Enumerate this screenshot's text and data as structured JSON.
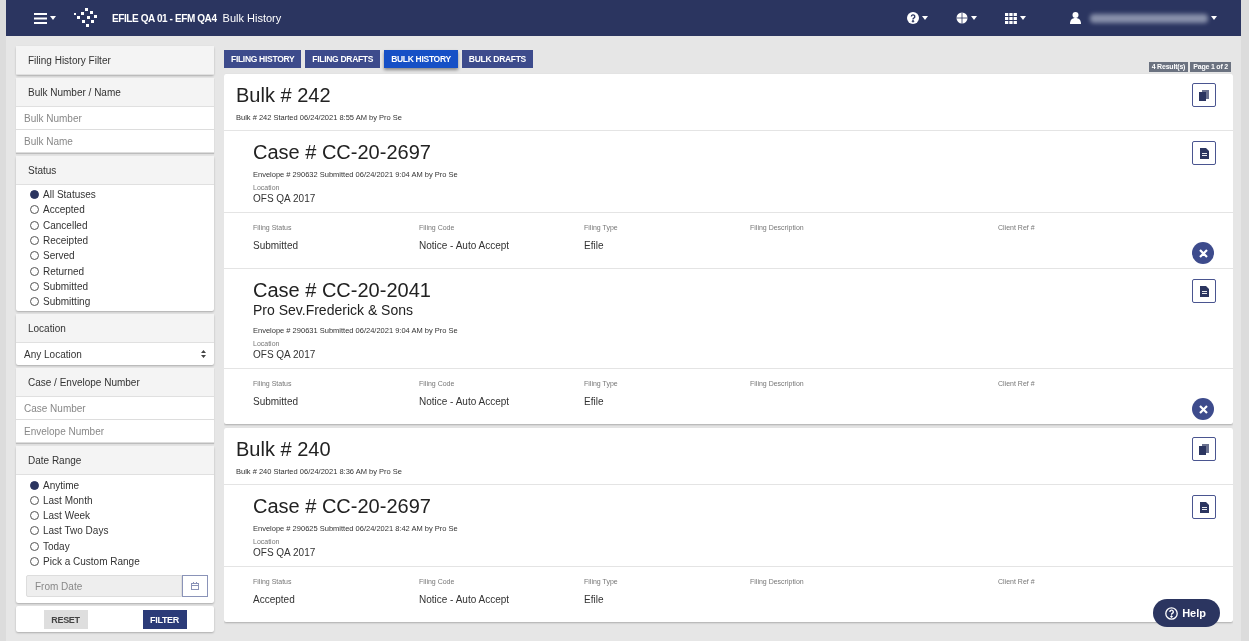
{
  "nav": {
    "brand": "EFILE QA 01 - EFM QA4",
    "page_title": "Bulk History"
  },
  "filter": {
    "title": "Filing History Filter",
    "sections": [
      {
        "kind": "fields",
        "title": "Bulk Number / Name",
        "fields": [
          {
            "placeholder": "Bulk Number"
          },
          {
            "placeholder": "Bulk Name"
          }
        ]
      },
      {
        "kind": "radios",
        "title": "Status",
        "options": [
          {
            "label": "All Statuses",
            "selected": true
          },
          {
            "label": "Accepted",
            "selected": false
          },
          {
            "label": "Cancelled",
            "selected": false
          },
          {
            "label": "Receipted",
            "selected": false
          },
          {
            "label": "Served",
            "selected": false
          },
          {
            "label": "Returned",
            "selected": false
          },
          {
            "label": "Submitted",
            "selected": false
          },
          {
            "label": "Submitting",
            "selected": false
          }
        ]
      },
      {
        "kind": "select",
        "title": "Location",
        "value": "Any Location"
      },
      {
        "kind": "fields",
        "title": "Case / Envelope Number",
        "fields": [
          {
            "placeholder": "Case Number"
          },
          {
            "placeholder": "Envelope Number"
          }
        ]
      },
      {
        "kind": "radios",
        "title": "Date Range",
        "options": [
          {
            "label": "Anytime",
            "selected": true
          },
          {
            "label": "Last Month",
            "selected": false
          },
          {
            "label": "Last Week",
            "selected": false
          },
          {
            "label": "Last Two Days",
            "selected": false
          },
          {
            "label": "Today",
            "selected": false
          },
          {
            "label": "Pick a Custom Range",
            "selected": false
          }
        ],
        "date_field": {
          "placeholder": "From Date"
        }
      }
    ],
    "buttons": [
      {
        "label": "RESET",
        "kind": "secondary"
      },
      {
        "label": "FILTER",
        "kind": "primary"
      }
    ]
  },
  "tabs": [
    {
      "label": "FILING HISTORY",
      "selected": false
    },
    {
      "label": "FILING DRAFTS",
      "selected": false
    },
    {
      "label": "BULK HISTORY",
      "selected": true
    },
    {
      "label": "BULK DRAFTS",
      "selected": false
    }
  ],
  "results": {
    "count": "4 Result(s)",
    "page": "Page 1 of 2"
  },
  "bulks": [
    {
      "title": "Bulk # 242",
      "subtitle": "Bulk # 242 Started 06/24/2021 8:55 AM by Pro Se",
      "cases": [
        {
          "title": "Case # CC-20-2697",
          "envelope": "Envelope # 290632 Submitted 06/24/2021 9:04 AM by Pro Se",
          "location_label": "Location",
          "location": "OFS QA 2017",
          "filing": [
            {
              "label": "Filing Status",
              "value": "Submitted"
            },
            {
              "label": "Filing Code",
              "value": "Notice - Auto Accept"
            },
            {
              "label": "Filing Type",
              "value": "Efile"
            },
            {
              "label": "Filing Description"
            },
            {
              "label": "Client Ref #"
            }
          ],
          "cancelable": true
        },
        {
          "title": "Case # CC-20-2041",
          "party": "Pro Sev.Frederick & Sons",
          "envelope": "Envelope # 290631 Submitted 06/24/2021 9:04 AM by Pro Se",
          "location_label": "Location",
          "location": "OFS QA 2017",
          "filing": [
            {
              "label": "Filing Status",
              "value": "Submitted"
            },
            {
              "label": "Filing Code",
              "value": "Notice - Auto Accept"
            },
            {
              "label": "Filing Type",
              "value": "Efile"
            },
            {
              "label": "Filing Description"
            },
            {
              "label": "Client Ref #"
            }
          ],
          "cancelable": true
        }
      ]
    },
    {
      "title": "Bulk # 240",
      "subtitle": "Bulk # 240 Started 06/24/2021 8:36 AM by Pro Se",
      "cases": [
        {
          "title": "Case # CC-20-2697",
          "envelope": "Envelope # 290625 Submitted 06/24/2021 8:42 AM by Pro Se",
          "location_label": "Location",
          "location": "OFS QA 2017",
          "filing": [
            {
              "label": "Filing Status",
              "value": "Accepted"
            },
            {
              "label": "Filing Code",
              "value": "Notice - Auto Accept"
            },
            {
              "label": "Filing Type",
              "value": "Efile"
            },
            {
              "label": "Filing Description"
            },
            {
              "label": "Client Ref #"
            }
          ],
          "cancelable": false
        }
      ]
    }
  ],
  "help": {
    "label": "Help"
  }
}
